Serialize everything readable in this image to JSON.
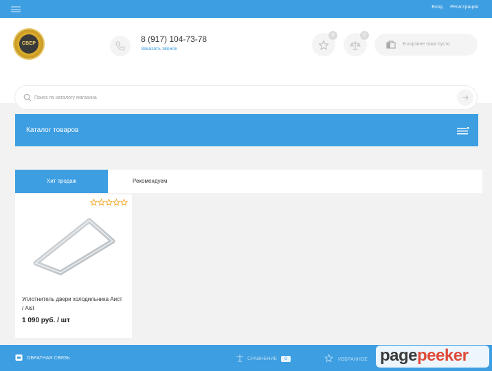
{
  "topbar": {
    "login": "Вход",
    "register": "Регистрация"
  },
  "header": {
    "logo_text": "СВЕР",
    "phone": "8 (917) 104-73-78",
    "callback": "Заказать звонок",
    "favorites_count": "0",
    "compare_count": "0",
    "cart_text": "В корзине пока пусто"
  },
  "search": {
    "placeholder": "Поиск по каталогу магазина"
  },
  "catalog": {
    "title": "Каталог товаров"
  },
  "tabs": [
    {
      "label": "Хит продаж",
      "active": true
    },
    {
      "label": "Рекомендуем",
      "active": false
    }
  ],
  "product": {
    "name": "Уплотнитель двери холодильника Аист / Aist",
    "price": "1 090 руб. / шт",
    "rating": 0
  },
  "bottombar": {
    "feedback": "ОБРАТНАЯ СВЯЗЬ",
    "compare": "СРАВНЕНИЕ",
    "compare_count": "0",
    "favorites": "ИЗБРАННОЕ"
  },
  "watermark": {
    "part1": "page",
    "part2": "peeker"
  },
  "colors": {
    "accent": "#3d9ee1",
    "background": "#f2f2f2",
    "watermark_red": "#e04a3a"
  }
}
